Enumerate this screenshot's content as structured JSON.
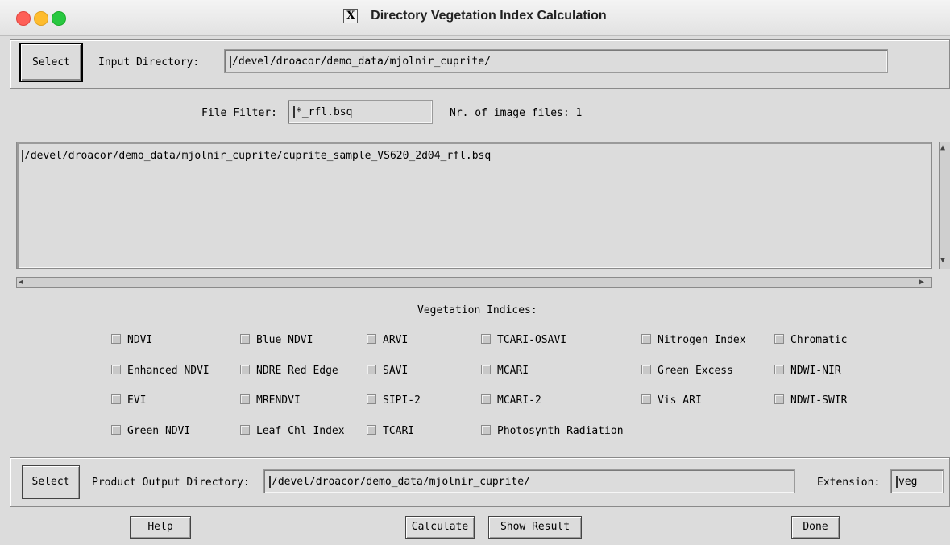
{
  "window": {
    "title": "Directory Vegetation Index Calculation",
    "x_logo": "X"
  },
  "input": {
    "select_label": "Select",
    "dir_label": "Input Directory:",
    "dir_value": "/devel/droacor/demo_data/mjolnir_cuprite/"
  },
  "filter": {
    "label": "File Filter:",
    "value": "*_rfl.bsq",
    "count_text": "Nr. of image files: 1"
  },
  "files": [
    "/devel/droacor/demo_data/mjolnir_cuprite/cuprite_sample_VS620_2d04_rfl.bsq"
  ],
  "scroll": {
    "up": "▲",
    "down": "▼",
    "left": "◀",
    "right": "▶"
  },
  "indices": {
    "heading": "Vegetation Indices:",
    "col1": [
      "NDVI",
      "Enhanced NDVI",
      "EVI",
      "Green NDVI"
    ],
    "col2": [
      "Blue NDVI",
      "NDRE Red Edge",
      "MRENDVI",
      "Leaf Chl Index"
    ],
    "col3": [
      "ARVI",
      "SAVI",
      "SIPI-2",
      "TCARI"
    ],
    "col4": [
      "TCARI-OSAVI",
      "MCARI",
      "MCARI-2",
      "Photosynth Radiation"
    ],
    "col5": [
      "Nitrogen Index",
      "Green Excess",
      "Vis ARI"
    ],
    "col6": [
      "Chromatic",
      "NDWI-NIR",
      "NDWI-SWIR"
    ]
  },
  "output": {
    "select_label": "Select",
    "dir_label": "Product Output Directory:",
    "dir_value": "/devel/droacor/demo_data/mjolnir_cuprite/",
    "ext_label": "Extension:",
    "ext_value": "veg"
  },
  "buttons": {
    "help": "Help",
    "calculate": "Calculate",
    "show_result": "Show Result",
    "done": "Done"
  },
  "colors": {
    "close": "#fe5f57",
    "minimize": "#febc2e",
    "zoom": "#28c840",
    "panel": "#dcdcdc"
  }
}
